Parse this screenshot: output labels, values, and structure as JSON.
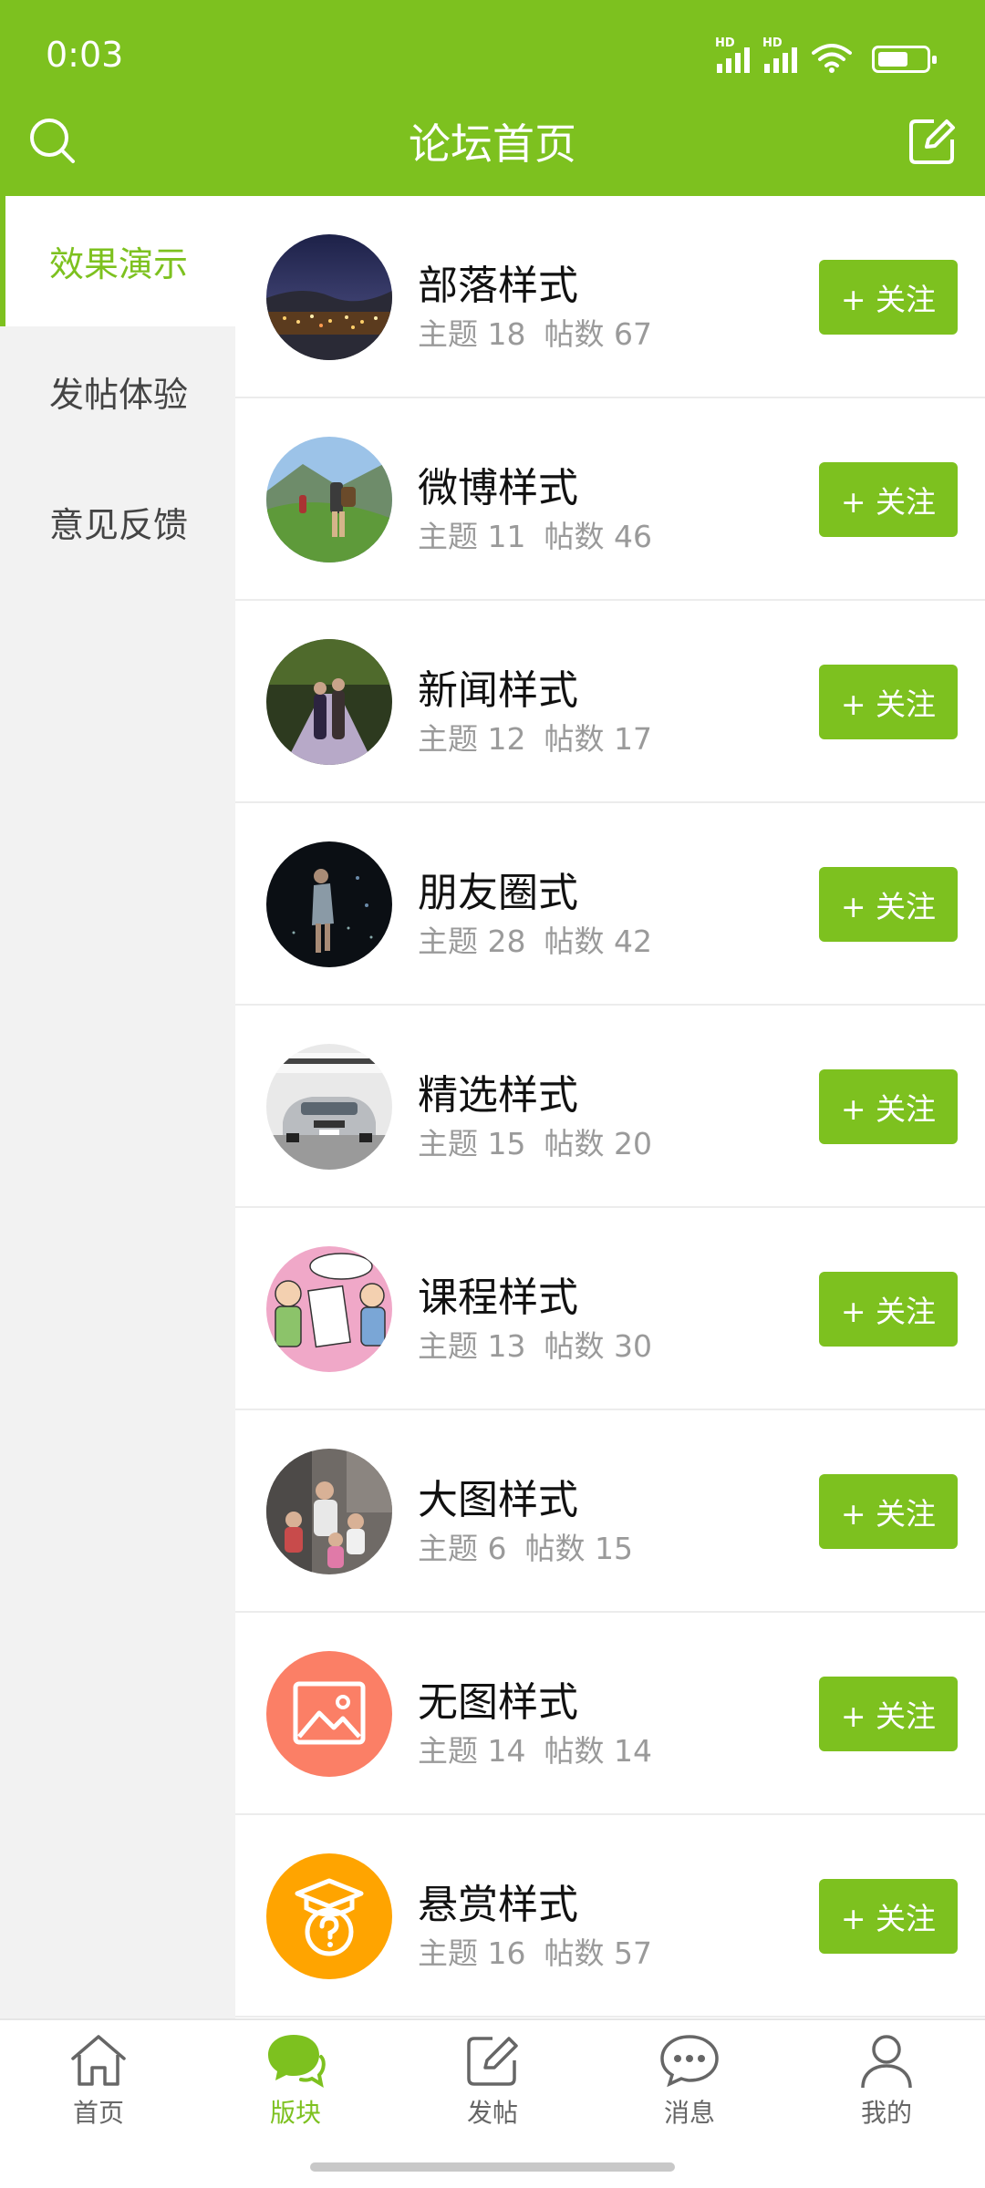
{
  "status_bar": {
    "time": "0:03",
    "signal_label": "HD"
  },
  "header": {
    "title": "论坛首页"
  },
  "sidebar": {
    "items": [
      {
        "label": "效果演示",
        "active": true
      },
      {
        "label": "发帖体验",
        "active": false
      },
      {
        "label": "意见反馈",
        "active": false
      }
    ]
  },
  "forums": [
    {
      "name": "部落样式",
      "topics_label": "主题 18",
      "posts_label": "帖数 67",
      "follow_label": "+ 关注",
      "icon": "city-night-photo"
    },
    {
      "name": "微博样式",
      "topics_label": "主题 11",
      "posts_label": "帖数 46",
      "follow_label": "+ 关注",
      "icon": "hikers-photo"
    },
    {
      "name": "新闻样式",
      "topics_label": "主题 12",
      "posts_label": "帖数 17",
      "follow_label": "+ 关注",
      "icon": "elderly-couple-photo"
    },
    {
      "name": "朋友圈式",
      "topics_label": "主题 28",
      "posts_label": "帖数 42",
      "follow_label": "+ 关注",
      "icon": "dancer-photo"
    },
    {
      "name": "精选样式",
      "topics_label": "主题 15",
      "posts_label": "帖数 20",
      "follow_label": "+ 关注",
      "icon": "car-photo"
    },
    {
      "name": "课程样式",
      "topics_label": "主题 13",
      "posts_label": "帖数 30",
      "follow_label": "+ 关注",
      "icon": "cartoon-photo"
    },
    {
      "name": "大图样式",
      "topics_label": "主题 6",
      "posts_label": "帖数 15",
      "follow_label": "+ 关注",
      "icon": "children-photo"
    },
    {
      "name": "无图样式",
      "topics_label": "主题 14",
      "posts_label": "帖数 14",
      "follow_label": "+ 关注",
      "icon": "image-placeholder-icon"
    },
    {
      "name": "悬赏样式",
      "topics_label": "主题 16",
      "posts_label": "帖数 57",
      "follow_label": "+ 关注",
      "icon": "graduation-question-icon"
    }
  ],
  "tabbar": {
    "items": [
      {
        "label": "首页",
        "icon": "home-icon",
        "active": false
      },
      {
        "label": "版块",
        "icon": "chat-bubbles-icon",
        "active": true
      },
      {
        "label": "发帖",
        "icon": "compose-icon",
        "active": false
      },
      {
        "label": "消息",
        "icon": "message-icon",
        "active": false
      },
      {
        "label": "我的",
        "icon": "user-icon",
        "active": false
      }
    ]
  },
  "colors": {
    "accent": "#7dc11f",
    "sidebar_bg": "#f2f2f2",
    "coral": "#fb7f66",
    "orange": "#ffa400"
  }
}
